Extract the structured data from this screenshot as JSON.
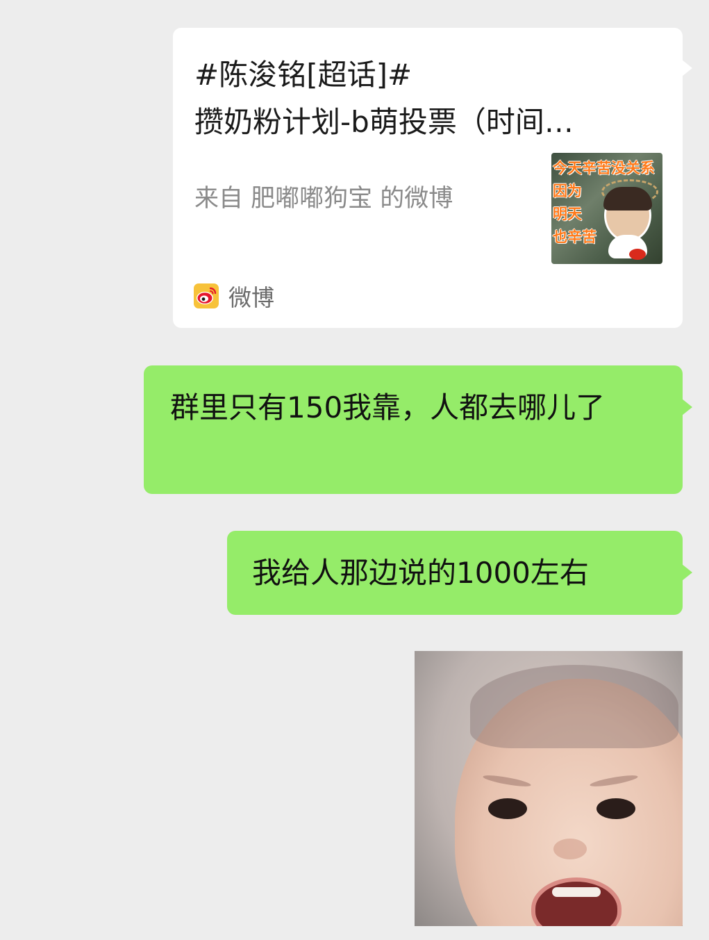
{
  "share_card": {
    "title_line1": "#陈浚铭[超话]#",
    "title_line2": "攒奶粉计划-b萌投票（时间…",
    "source": "来自 肥嘟嘟狗宝 的微博",
    "thumbnail_text": "今天辛苦没关系\n因为\n明天\n也辛苦",
    "app_label": "微博",
    "app_icon": "weibo-icon"
  },
  "messages": [
    {
      "text": "群里只有150我靠，人都去哪儿了"
    },
    {
      "text": "我给人那边说的1000左右"
    }
  ],
  "sticker": {
    "icon": "crying-baby-sticker"
  },
  "colors": {
    "background": "#ededed",
    "outgoing_bubble": "#95ec69",
    "card": "#ffffff",
    "weibo_red": "#e6162d",
    "weibo_yellow": "#f5a623"
  }
}
